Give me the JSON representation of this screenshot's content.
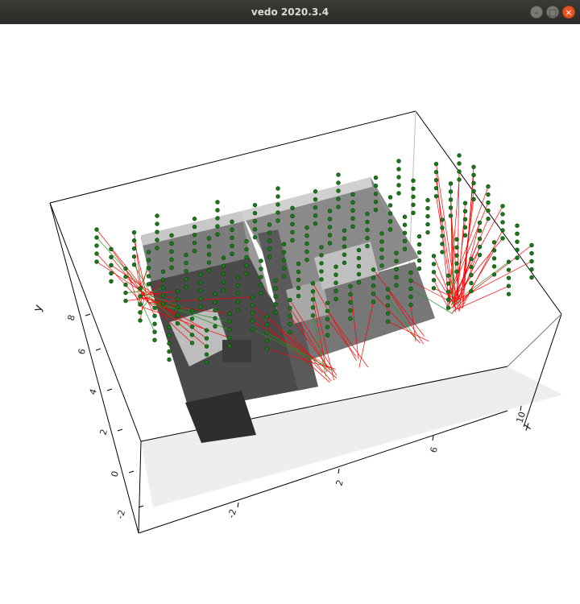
{
  "window": {
    "title": "vedo 2020.3.4",
    "buttons": {
      "minimize": "–",
      "maximize": "□",
      "close": "×"
    }
  },
  "scene": {
    "axes": {
      "x_label": "x",
      "y_label": "y",
      "x_ticks": [
        "-2",
        "2",
        "6",
        "10"
      ],
      "y_ticks": [
        "-2",
        "0",
        "2",
        "4",
        "6",
        "8"
      ]
    },
    "colors": {
      "box": "#000000",
      "floor": "#ececec",
      "points": "#1a7a1a",
      "red_rays": "#ff0000",
      "green_rays": "#1a9a1a",
      "mesh": "#6e6e6e"
    }
  }
}
